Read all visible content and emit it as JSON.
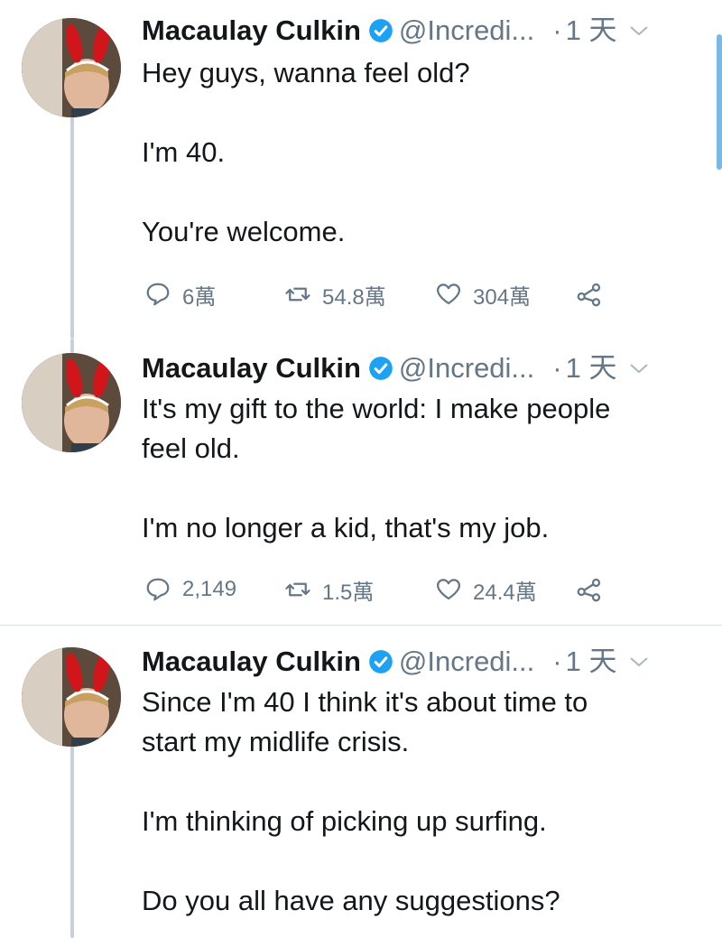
{
  "colors": {
    "accent": "#1da1f2",
    "muted": "#657786",
    "text": "#14171a",
    "thread_line": "#c6d0d6"
  },
  "tweets": [
    {
      "name": "Macaulay Culkin",
      "handle": "@Incredi...",
      "dot": "·",
      "time": "1 天",
      "text": [
        "Hey guys, wanna feel old?",
        "",
        "I'm 40.",
        "",
        "You're welcome."
      ],
      "replies": "6萬",
      "retweets": "54.8萬",
      "likes": "304萬"
    },
    {
      "name": "Macaulay Culkin",
      "handle": "@Incredi...",
      "dot": "·",
      "time": "1 天",
      "text": [
        "It's my gift to the world: I make people",
        "feel old.",
        "",
        "I'm no longer a kid, that's my job."
      ],
      "replies": "2,149",
      "retweets": "1.5萬",
      "likes": "24.4萬"
    },
    {
      "name": "Macaulay Culkin",
      "handle": "@Incredi...",
      "dot": "·",
      "time": "1 天",
      "text": [
        "Since I'm 40 I think it's about time to",
        "start my midlife crisis.",
        "",
        "I'm thinking of picking up surfing.",
        "",
        "Do you all have any suggestions?"
      ]
    }
  ],
  "icons": {
    "reply": "reply-icon",
    "retweet": "retweet-icon",
    "like": "heart-icon",
    "share": "share-icon",
    "verified": "verified-badge-icon",
    "menu": "chevron-down-icon"
  }
}
